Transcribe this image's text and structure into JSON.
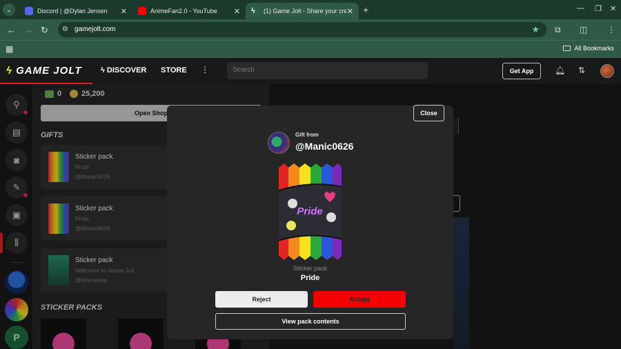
{
  "browser": {
    "tabs": [
      {
        "title": "Discord | @Dylan Jensen",
        "favicon_color": "#5865f2"
      },
      {
        "title": "AnimeFan2.0 - YouTube",
        "favicon_color": "#ff0000"
      },
      {
        "title": "(1) Game Jolt - Share your crea",
        "favicon_color": "#ccff00"
      }
    ],
    "url": "gamejolt.com",
    "all_bookmarks": "All Bookmarks",
    "theme_colors": {
      "frame": "#1b3a2c",
      "toolbar": "#2f5a45"
    }
  },
  "site": {
    "logo": "GAME JOLT",
    "nav": {
      "discover": "DISCOVER",
      "store": "STORE"
    },
    "search_placeholder": "Search",
    "get_app": "Get App"
  },
  "panel": {
    "balance_gems": "0",
    "balance_coins": "25,200",
    "open_shop": "Open Shop",
    "gifts_heading": "GIFTS",
    "gifts": [
      {
        "title": "Sticker pack",
        "subtitle": "Pride",
        "from": "@Manic0626"
      },
      {
        "title": "Sticker pack",
        "subtitle": "Pride",
        "from": "@Manic0626"
      },
      {
        "title": "Sticker pack",
        "subtitle": "Welcome to Game Jolt",
        "from": "@Manueloa"
      }
    ],
    "sticker_packs_heading": "STICKER PACKS"
  },
  "modal": {
    "close": "Close",
    "gift_from_label": "Gift from",
    "gift_from_user": "@Manic0626",
    "pack_type": "Sticker pack",
    "pack_name": "Pride",
    "pack_art_text": "Pride",
    "reject": "Reject",
    "accept": "Accept",
    "view_contents": "View pack contents",
    "accept_color": "#f40000"
  }
}
